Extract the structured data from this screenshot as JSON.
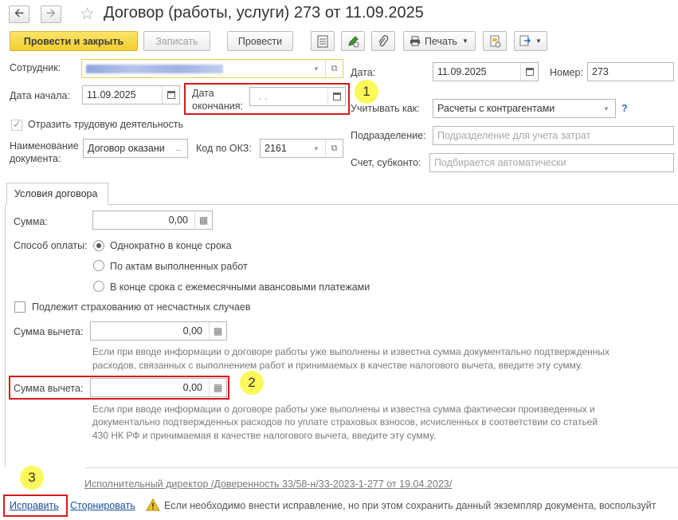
{
  "window": {
    "title": "Договор (работы, услуги) 273 от 11.09.2025"
  },
  "toolbar": {
    "post_close": "Провести и закрыть",
    "save": "Записать",
    "post": "Провести",
    "print": "Печать"
  },
  "header": {
    "employee_label": "Сотрудник:",
    "start_date_label": "Дата начала:",
    "start_date_value": "11.09.2025",
    "end_date_label_1": "Дата",
    "end_date_label_2": "окончания:",
    "end_date_value": ". .",
    "reflect_label": "Отразить трудовую деятельность",
    "docname_label_1": "Наименование",
    "docname_label_2": "документа:",
    "docname_value": "Договор оказани",
    "okz_label": "Код по ОКЗ:",
    "okz_value": "2161",
    "date_label": "Дата:",
    "date_value": "11.09.2025",
    "number_label": "Номер:",
    "number_value": "273",
    "account_as_label": "Учитывать как:",
    "account_as_value": "Расчеты с контрагентами",
    "help": "?",
    "department_label": "Подразделение:",
    "department_placeholder": "Подразделение для учета затрат",
    "account_label": "Счет, субконто:",
    "account_placeholder": "Подбирается автоматически"
  },
  "tab": {
    "label": "Условия договора"
  },
  "conditions": {
    "sum_label": "Сумма:",
    "sum_value": "0,00",
    "payment_label": "Способ оплаты:",
    "payment_options": [
      "Однократно в конце срока",
      "По актам выполненных работ",
      "В конце срока с ежемесячными авансовыми платежами"
    ],
    "insurance_label": "Подлежит страхованию от несчастных случаев",
    "deduction1_label": "Сумма вычета:",
    "deduction1_value": "0,00",
    "deduction1_hint_1": "Если при вводе информации о договоре работы уже выполнены и известна сумма документально подтвержденных",
    "deduction1_hint_2": "расходов, связанных с выполнением работ и принимаемых в качестве налогового вычета, введите эту сумму.",
    "deduction2_label": "Сумма вычета:",
    "deduction2_value": "0,00",
    "deduction2_hint_1": "Если при вводе информации о договоре работы уже выполнены и известна сумма фактически произведенных и",
    "deduction2_hint_2": "документально подтвержденных расходов по уплате страховых взносов, исчисленных в соответствии со статьей",
    "deduction2_hint_3": "430 НК РФ и принимаемая в качестве налогового вычета, введите эту сумму."
  },
  "footer": {
    "signer_link": "Исполнительный директор /Доверенность 33/58-н/33-2023-1-277 от 19.04.2023/",
    "fix_link": "Исправить",
    "reverse_link": "Сторнировать",
    "warning_text": "Если необходимо внести исправление, но при этом сохранить данный экземпляр документа, воспользуйт"
  },
  "markers": {
    "m1": "1",
    "m2": "2",
    "m3": "3"
  },
  "colors": {
    "primary_button": "#f2ce2d",
    "highlight_box": "#d31a1a",
    "marker": "#fbf95a",
    "link": "#1a4f9c"
  }
}
